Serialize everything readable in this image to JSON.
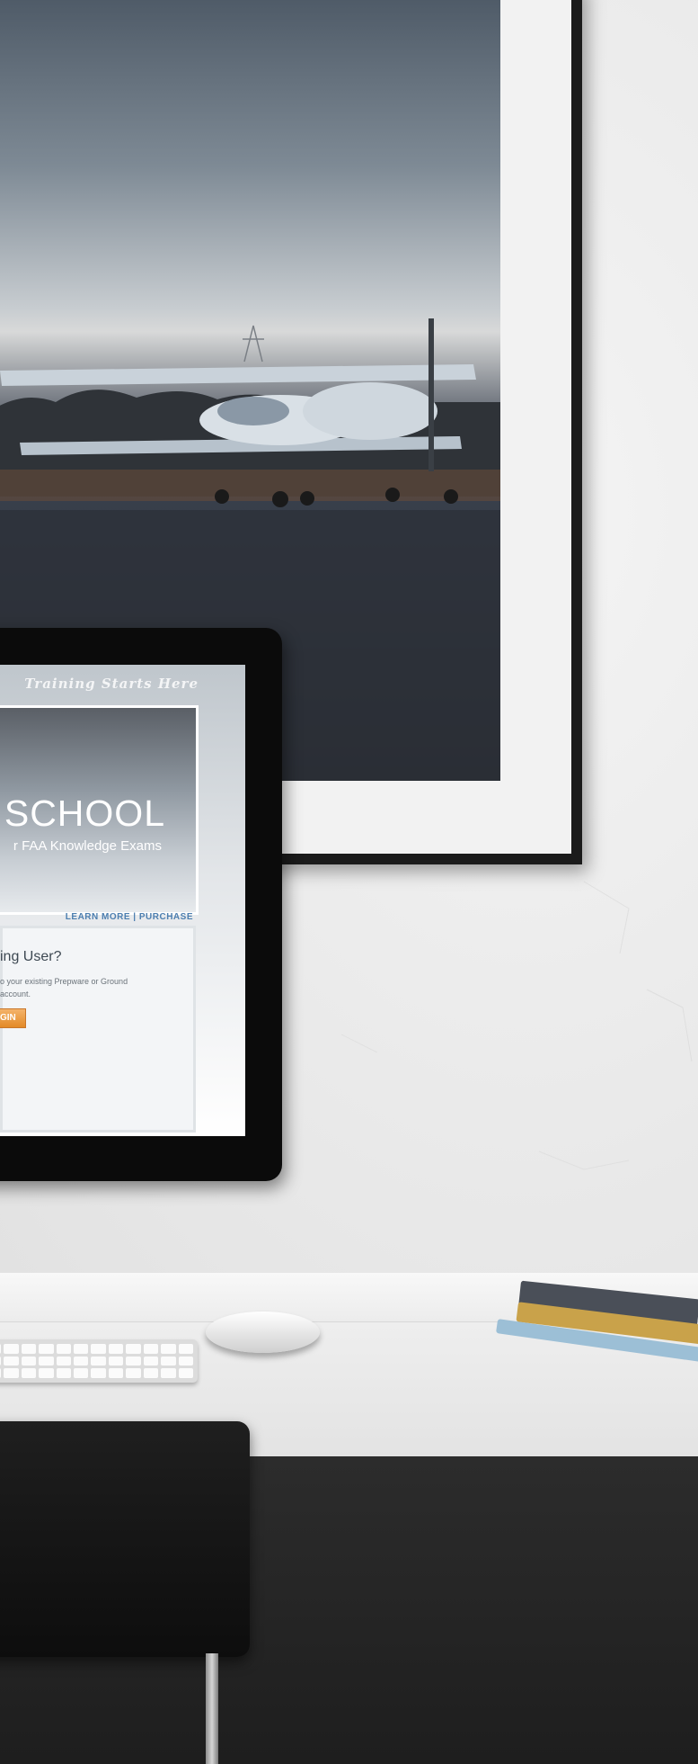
{
  "screen": {
    "tagline": "Training Starts Here",
    "banner_title": "SCHOOL",
    "banner_subtitle": "r FAA Knowledge Exams",
    "links": "LEARN MORE | PURCHASE",
    "returning_heading": "ing User?",
    "returning_text_line1": "o your existing Prepware or Ground",
    "returning_text_line2": "account.",
    "login_label": "GIN"
  },
  "icons": [
    "airplane",
    "keyboard",
    "mouse",
    "books",
    "chair"
  ]
}
